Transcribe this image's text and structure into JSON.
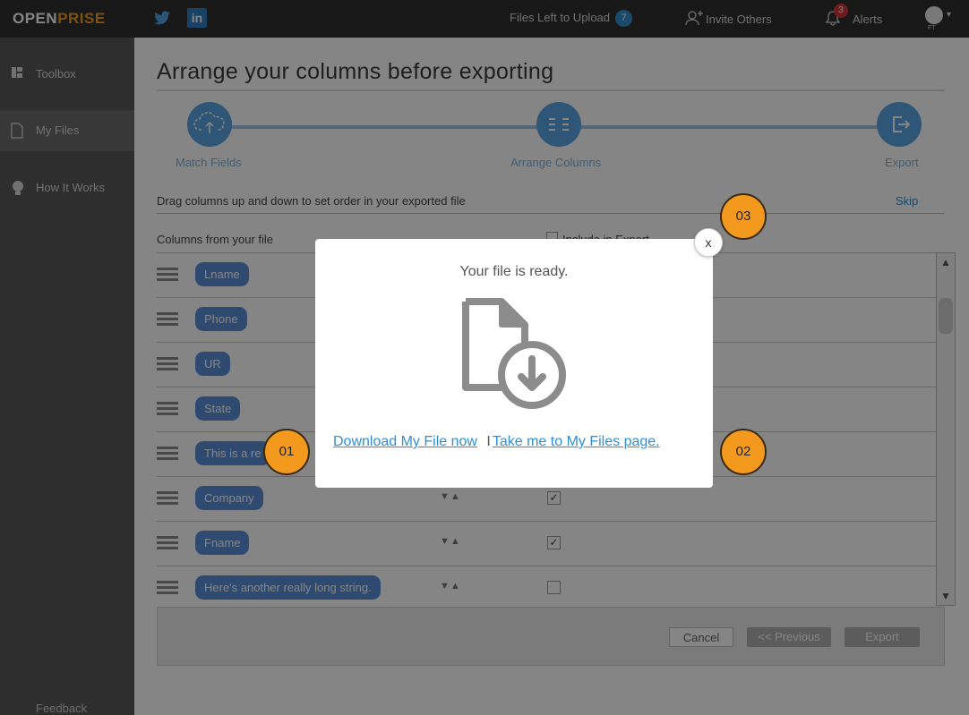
{
  "app": {
    "logo_left": "OPEN",
    "logo_right": "PRISE",
    "accent_color": "#f39a1e",
    "primary_color": "#5aa6e4"
  },
  "topbar": {
    "files_left_label": "Files Left to Upload",
    "files_left_count": "7",
    "invite_label": "Invite Others",
    "alerts_label": "Alerts",
    "alerts_count": "3",
    "avatar_label": "FT"
  },
  "sidebar": {
    "items": [
      {
        "label": "Toolbox",
        "icon": "toolbox-icon"
      },
      {
        "label": "My Files",
        "icon": "file-icon"
      },
      {
        "label": "How It Works",
        "icon": "lightbulb-icon"
      }
    ],
    "feedback_label": "Feedback"
  },
  "main": {
    "title": "Arrange your columns before exporting",
    "steps": [
      {
        "label": "Match Fields",
        "icon": "cloud-upload-icon"
      },
      {
        "label": "Arrange Columns",
        "icon": "columns-icon"
      },
      {
        "label": "Export",
        "icon": "export-icon"
      }
    ],
    "instruction": "Drag columns up and down to set order in your exported file",
    "skip_label": "Skip",
    "columns_header": "Columns from your file",
    "include_label": "Include in Export",
    "rows": [
      {
        "label": "Lname",
        "checked": ""
      },
      {
        "label": "Phone",
        "checked": ""
      },
      {
        "label": "UR",
        "checked": ""
      },
      {
        "label": "State",
        "checked": ""
      },
      {
        "label": "This is a re",
        "checked": ""
      },
      {
        "label": "Company",
        "checked": "✓"
      },
      {
        "label": "Fname",
        "checked": "✓"
      },
      {
        "label": "Here's another really long string.",
        "checked": ""
      }
    ],
    "sort_arrows": "▼▲",
    "cancel_label": "Cancel",
    "previous_label": "<< Previous",
    "export_label": "Export"
  },
  "modal": {
    "title": "Your file is ready.",
    "download_link": "Download My File now",
    "separator": "I",
    "files_link": "Take me to My Files page.",
    "close_label": "x",
    "icon": "file-download-icon"
  },
  "callouts": [
    "01",
    "02",
    "03"
  ]
}
